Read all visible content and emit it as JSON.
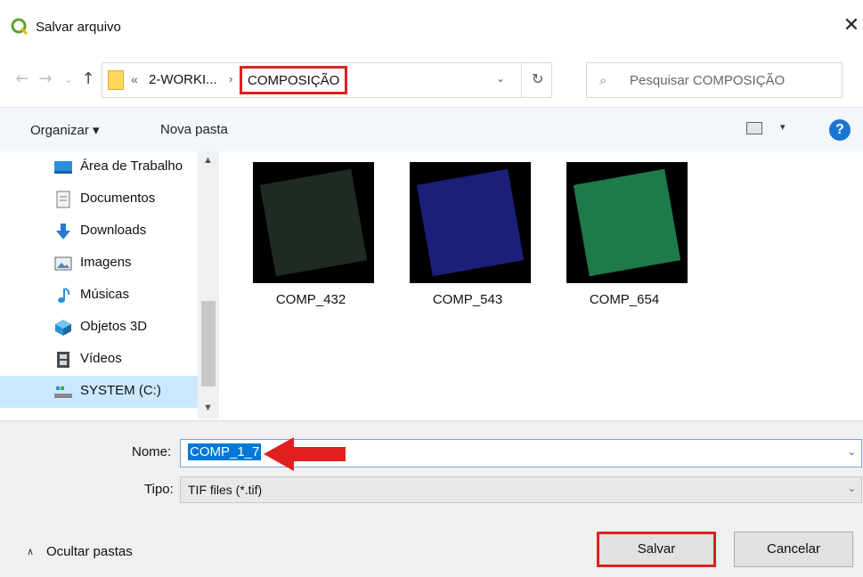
{
  "window": {
    "title": "Salvar arquivo",
    "close_label": "✕"
  },
  "nav": {
    "back_icon": "←",
    "forward_icon": "→",
    "recent_icon": "⌄",
    "up_icon": "↑"
  },
  "address": {
    "chevron": "«",
    "crumb_parent": "2-WORKI...",
    "separator": "›",
    "crumb_current": "COMPOSIÇÃO",
    "dropdown_icon": "⌄",
    "refresh_icon": "↻"
  },
  "search": {
    "icon": "⌕",
    "placeholder": "Pesquisar COMPOSIÇÃO"
  },
  "toolbar": {
    "organizar": "Organizar ▾",
    "nova_pasta": "Nova pasta",
    "view_drop": "▾",
    "help": "?"
  },
  "sidebar": {
    "items": [
      {
        "label": "Área de Trabalho",
        "icon": "desktop-icon"
      },
      {
        "label": "Documentos",
        "icon": "documents-icon"
      },
      {
        "label": "Downloads",
        "icon": "downloads-icon"
      },
      {
        "label": "Imagens",
        "icon": "pictures-icon"
      },
      {
        "label": "Músicas",
        "icon": "music-icon"
      },
      {
        "label": "Objetos 3D",
        "icon": "objects-3d-icon"
      },
      {
        "label": "Vídeos",
        "icon": "videos-icon"
      },
      {
        "label": "SYSTEM (C:)",
        "icon": "drive-icon",
        "selected": true
      }
    ],
    "scroll_up": "▲",
    "scroll_down": "▼"
  },
  "files": [
    {
      "name": "COMP_432",
      "tint": "#1f2a22"
    },
    {
      "name": "COMP_543",
      "tint": "#1b1f7a"
    },
    {
      "name": "COMP_654",
      "tint": "#1f7a4a"
    }
  ],
  "form": {
    "nome_label": "Nome:",
    "nome_value": "COMP_1_7",
    "tipo_label": "Tipo:",
    "tipo_value": "TIF files (*.tif)",
    "drop_icon": "⌄"
  },
  "footer": {
    "hide_folders": "Ocultar pastas",
    "hide_chevron": "∧",
    "save": "Salvar",
    "cancel": "Cancelar"
  },
  "colors": {
    "highlight": "#e02020",
    "selection": "#0078d7"
  }
}
